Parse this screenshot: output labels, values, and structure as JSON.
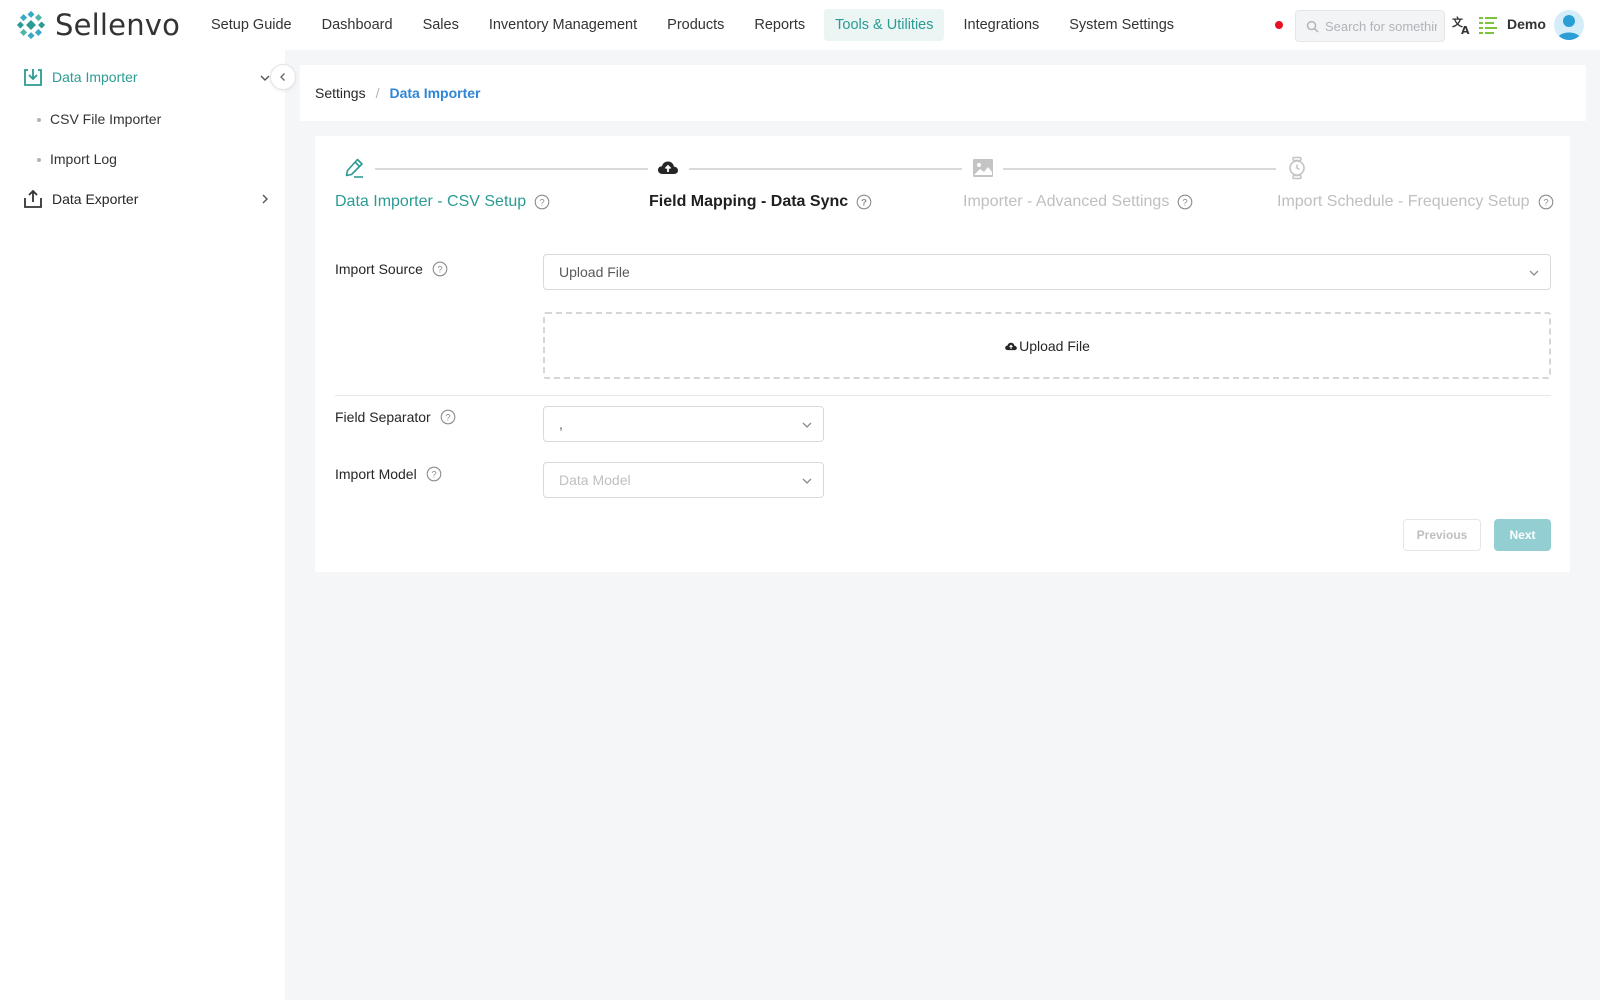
{
  "app": {
    "brand": "Sellenvo",
    "user_name": "Demo"
  },
  "nav": {
    "items": [
      {
        "label": "Setup Guide"
      },
      {
        "label": "Dashboard"
      },
      {
        "label": "Sales"
      },
      {
        "label": "Inventory Management"
      },
      {
        "label": "Products"
      },
      {
        "label": "Reports"
      },
      {
        "label": "Tools & Utilities",
        "active": true
      },
      {
        "label": "Integrations"
      },
      {
        "label": "System Settings"
      }
    ]
  },
  "search": {
    "placeholder": "Search for something"
  },
  "sidebar": {
    "groups": [
      {
        "label": "Data Importer",
        "icon": "download-tray-icon",
        "expanded": true,
        "children": [
          {
            "label": "CSV File Importer"
          },
          {
            "label": "Import Log"
          }
        ]
      },
      {
        "label": "Data Exporter",
        "icon": "upload-tray-icon",
        "expanded": false
      }
    ]
  },
  "breadcrumb": {
    "root": "Settings",
    "separator": "/",
    "current": "Data Importer"
  },
  "steps": [
    {
      "title": "Data Importer - CSV Setup",
      "state": "done",
      "icon": "pen-icon"
    },
    {
      "title": "Field Mapping - Data Sync",
      "state": "current",
      "icon": "cloud-upload-icon"
    },
    {
      "title": "Importer - Advanced Settings",
      "state": "pending",
      "icon": "image-icon"
    },
    {
      "title": "Import Schedule - Frequency Setup",
      "state": "pending",
      "icon": "watch-icon"
    }
  ],
  "form": {
    "import_source": {
      "label": "Import Source",
      "value": "Upload File"
    },
    "upload": {
      "label": "Upload File"
    },
    "field_separator": {
      "label": "Field Separator",
      "value": ","
    },
    "import_model": {
      "label": "Import Model",
      "placeholder": "Data Model"
    }
  },
  "buttons": {
    "previous": "Previous",
    "next": "Next"
  },
  "colors": {
    "accent": "#2b9b93",
    "link": "#2f86d6",
    "status_dot": "#e81123",
    "next_button": "#93cfd2"
  }
}
